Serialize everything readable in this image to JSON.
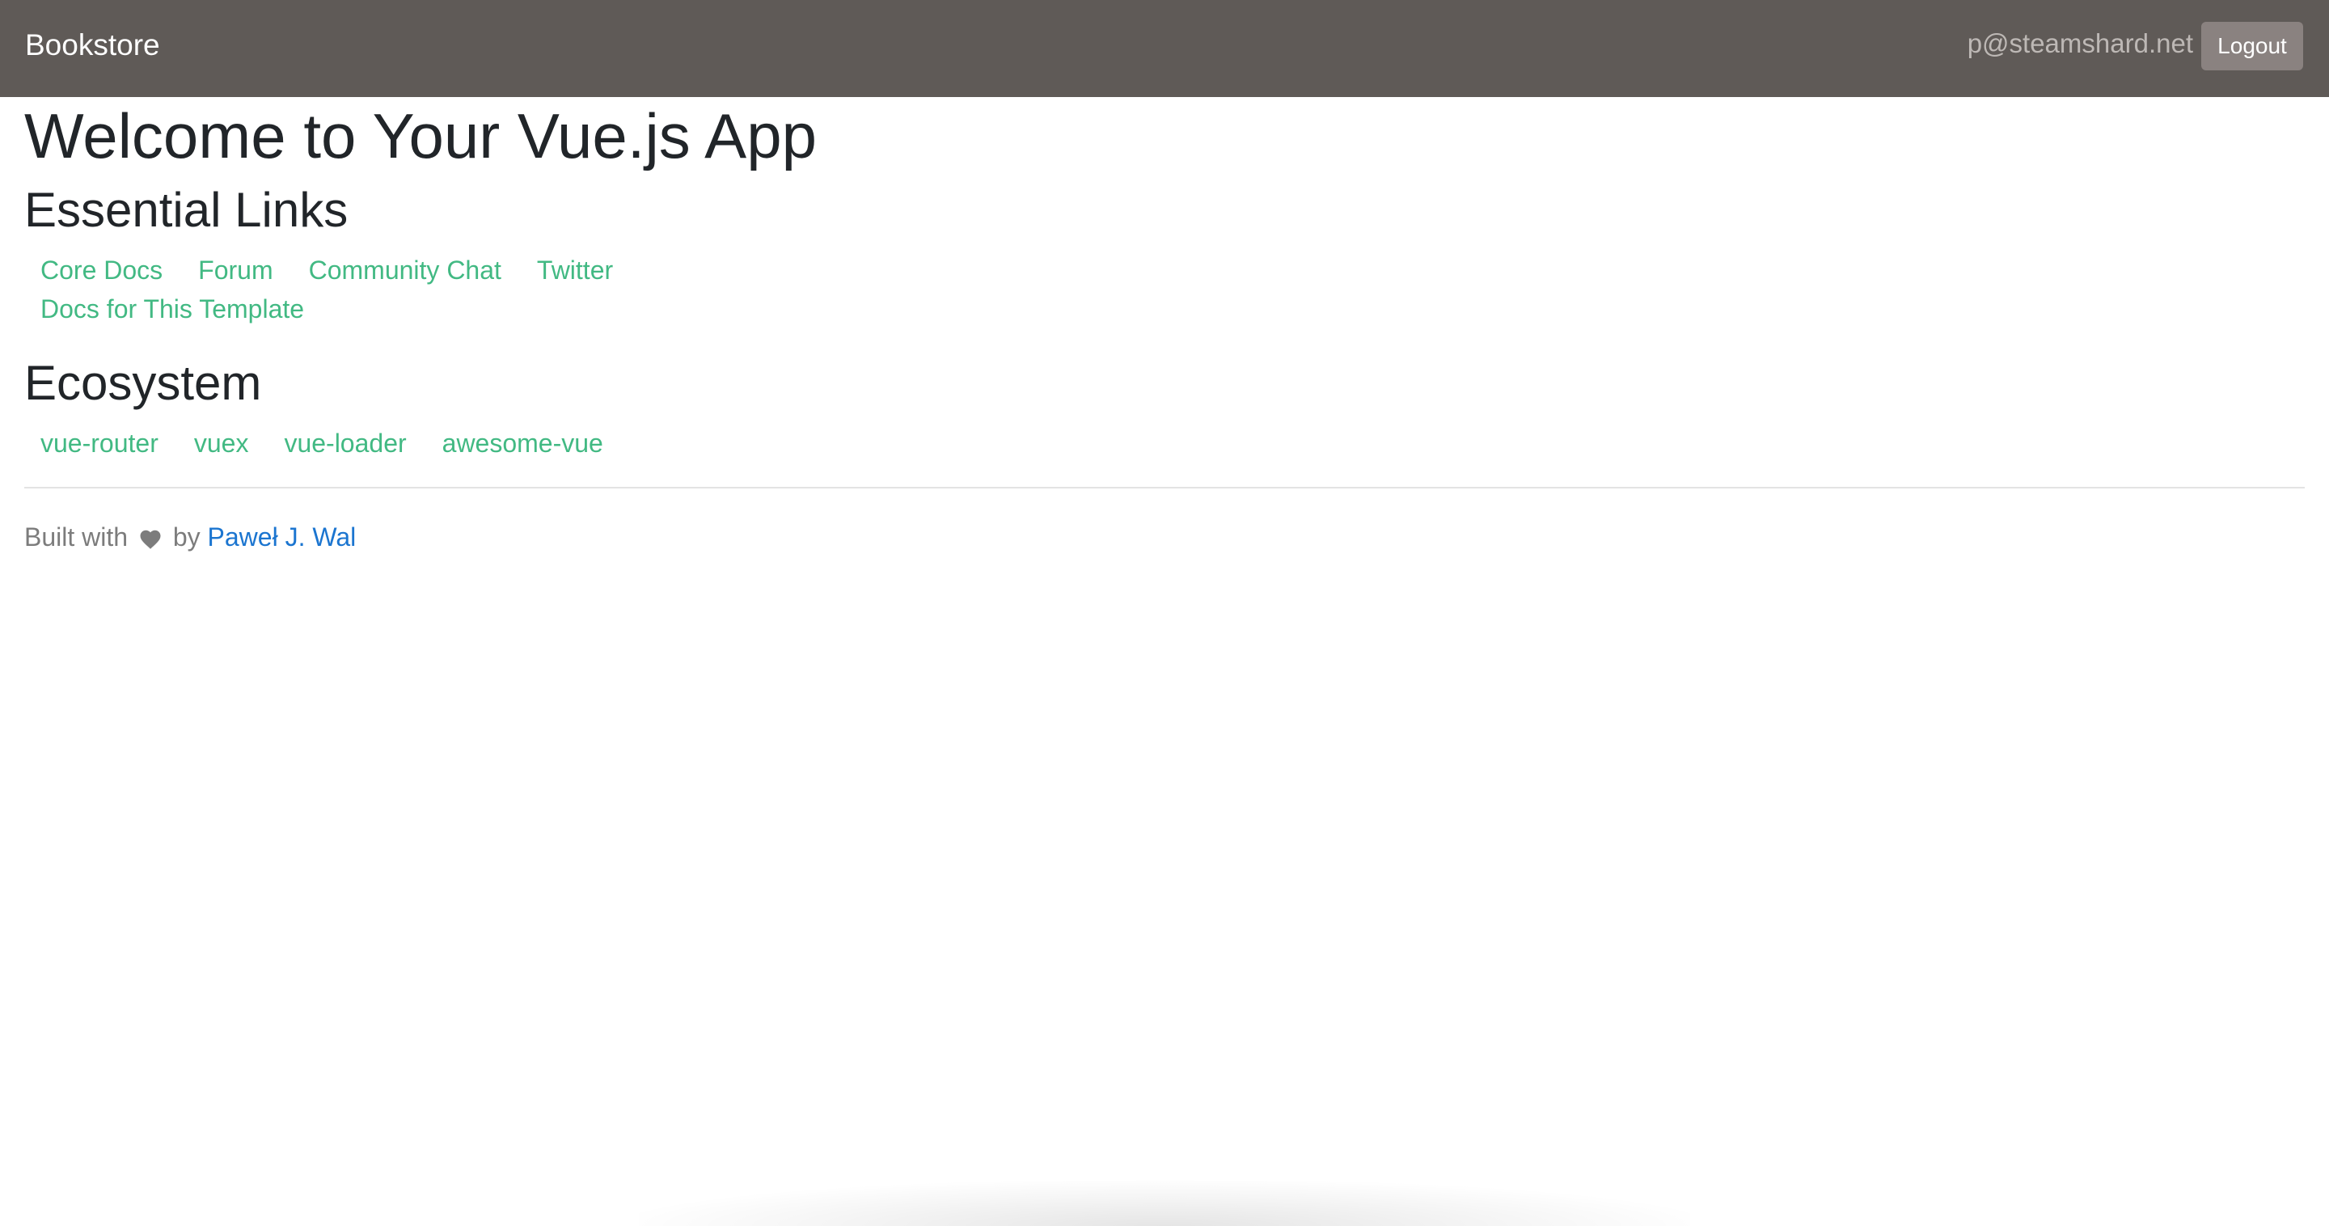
{
  "navbar": {
    "brand": "Bookstore",
    "user_email": "p@steamshard.net",
    "logout_label": "Logout"
  },
  "main": {
    "title": "Welcome to Your Vue.js App",
    "essential_links": {
      "heading": "Essential Links",
      "items": [
        {
          "label": "Core Docs"
        },
        {
          "label": "Forum"
        },
        {
          "label": "Community Chat"
        },
        {
          "label": "Twitter"
        },
        {
          "label": "Docs for This Template"
        }
      ]
    },
    "ecosystem": {
      "heading": "Ecosystem",
      "items": [
        {
          "label": "vue-router"
        },
        {
          "label": "vuex"
        },
        {
          "label": "vue-loader"
        },
        {
          "label": "awesome-vue"
        }
      ]
    }
  },
  "footer": {
    "prefix": "Built with",
    "heart_icon": "heart-icon",
    "middle": "by",
    "author": "Paweł J. Wal"
  },
  "colors": {
    "navbar_bg": "#5f5a57",
    "link_green": "#42b983",
    "author_link_blue": "#1b75d0",
    "logout_bg": "#8a8280"
  }
}
